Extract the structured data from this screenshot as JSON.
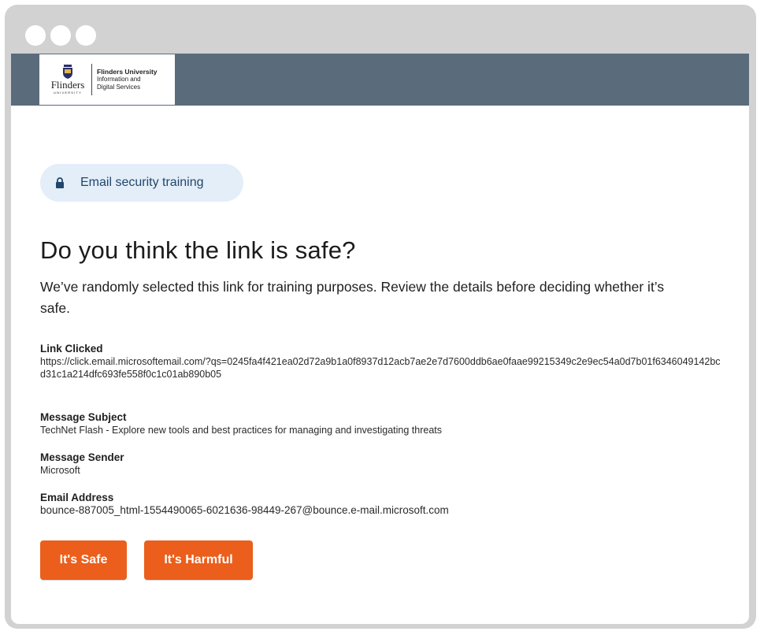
{
  "window": {
    "controls": [
      "dot",
      "dot",
      "dot"
    ]
  },
  "header": {
    "logo_wordmark": "Flinders",
    "logo_wordmark_sub": "UNIVERSITY",
    "logo_line1": "Flinders University",
    "logo_line2": "Information and",
    "logo_line3": "Digital Services",
    "bar_color": "#5a6b7c"
  },
  "badge": {
    "icon": "lock-icon",
    "label": "Email security training"
  },
  "main": {
    "title": "Do you think the link is safe?",
    "intro": "We’ve randomly selected this link for training purposes. Review the details before deciding whether it’s safe."
  },
  "details": {
    "link": {
      "label": "Link Clicked",
      "value": "https://click.email.microsoftemail.com/?qs=0245fa4f421ea02d72a9b1a0f8937d12acb7ae2e7d7600ddb6ae0faae99215349c2e9ec54a0d7b01f6346049142bcd31c1a214dfc693fe558f0c1c01ab890b05"
    },
    "subject": {
      "label": "Message Subject",
      "value": "TechNet Flash - Explore new tools and best practices for managing and investigating threats"
    },
    "sender": {
      "label": "Message Sender",
      "value": "Microsoft"
    },
    "address": {
      "label": "Email Address",
      "value": "bounce-887005_html-1554490065-6021636-98449-267@bounce.e-mail.microsoft.com"
    }
  },
  "actions": {
    "safe_label": "It's Safe",
    "harmful_label": "It's Harmful",
    "accent": "#eb5e1c"
  }
}
